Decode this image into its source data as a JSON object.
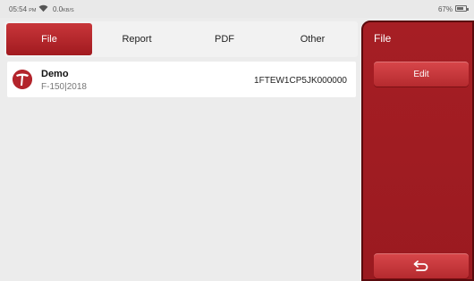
{
  "status": {
    "time": "05:54",
    "ampm": "PM",
    "speed": "0.0",
    "speed_unit": "KB/S",
    "battery": "67%",
    "battery_level": 0.67,
    "wifi_icon": "wifi-icon",
    "battery_icon": "battery-icon"
  },
  "tabs": [
    {
      "label": "File",
      "active": true
    },
    {
      "label": "Report",
      "active": false
    },
    {
      "label": "PDF",
      "active": false
    },
    {
      "label": "Other",
      "active": false
    }
  ],
  "records": [
    {
      "name": "Demo",
      "model": "F-150|2018",
      "vin": "1FTEW1CP5JK000000",
      "logo_icon": "brand-logo-icon"
    }
  ],
  "side_panel": {
    "title": "File",
    "edit_label": "Edit",
    "back_icon": "back-arrow-icon"
  },
  "colors": {
    "accent": "#a81e24",
    "panel": "#9e1b21"
  }
}
